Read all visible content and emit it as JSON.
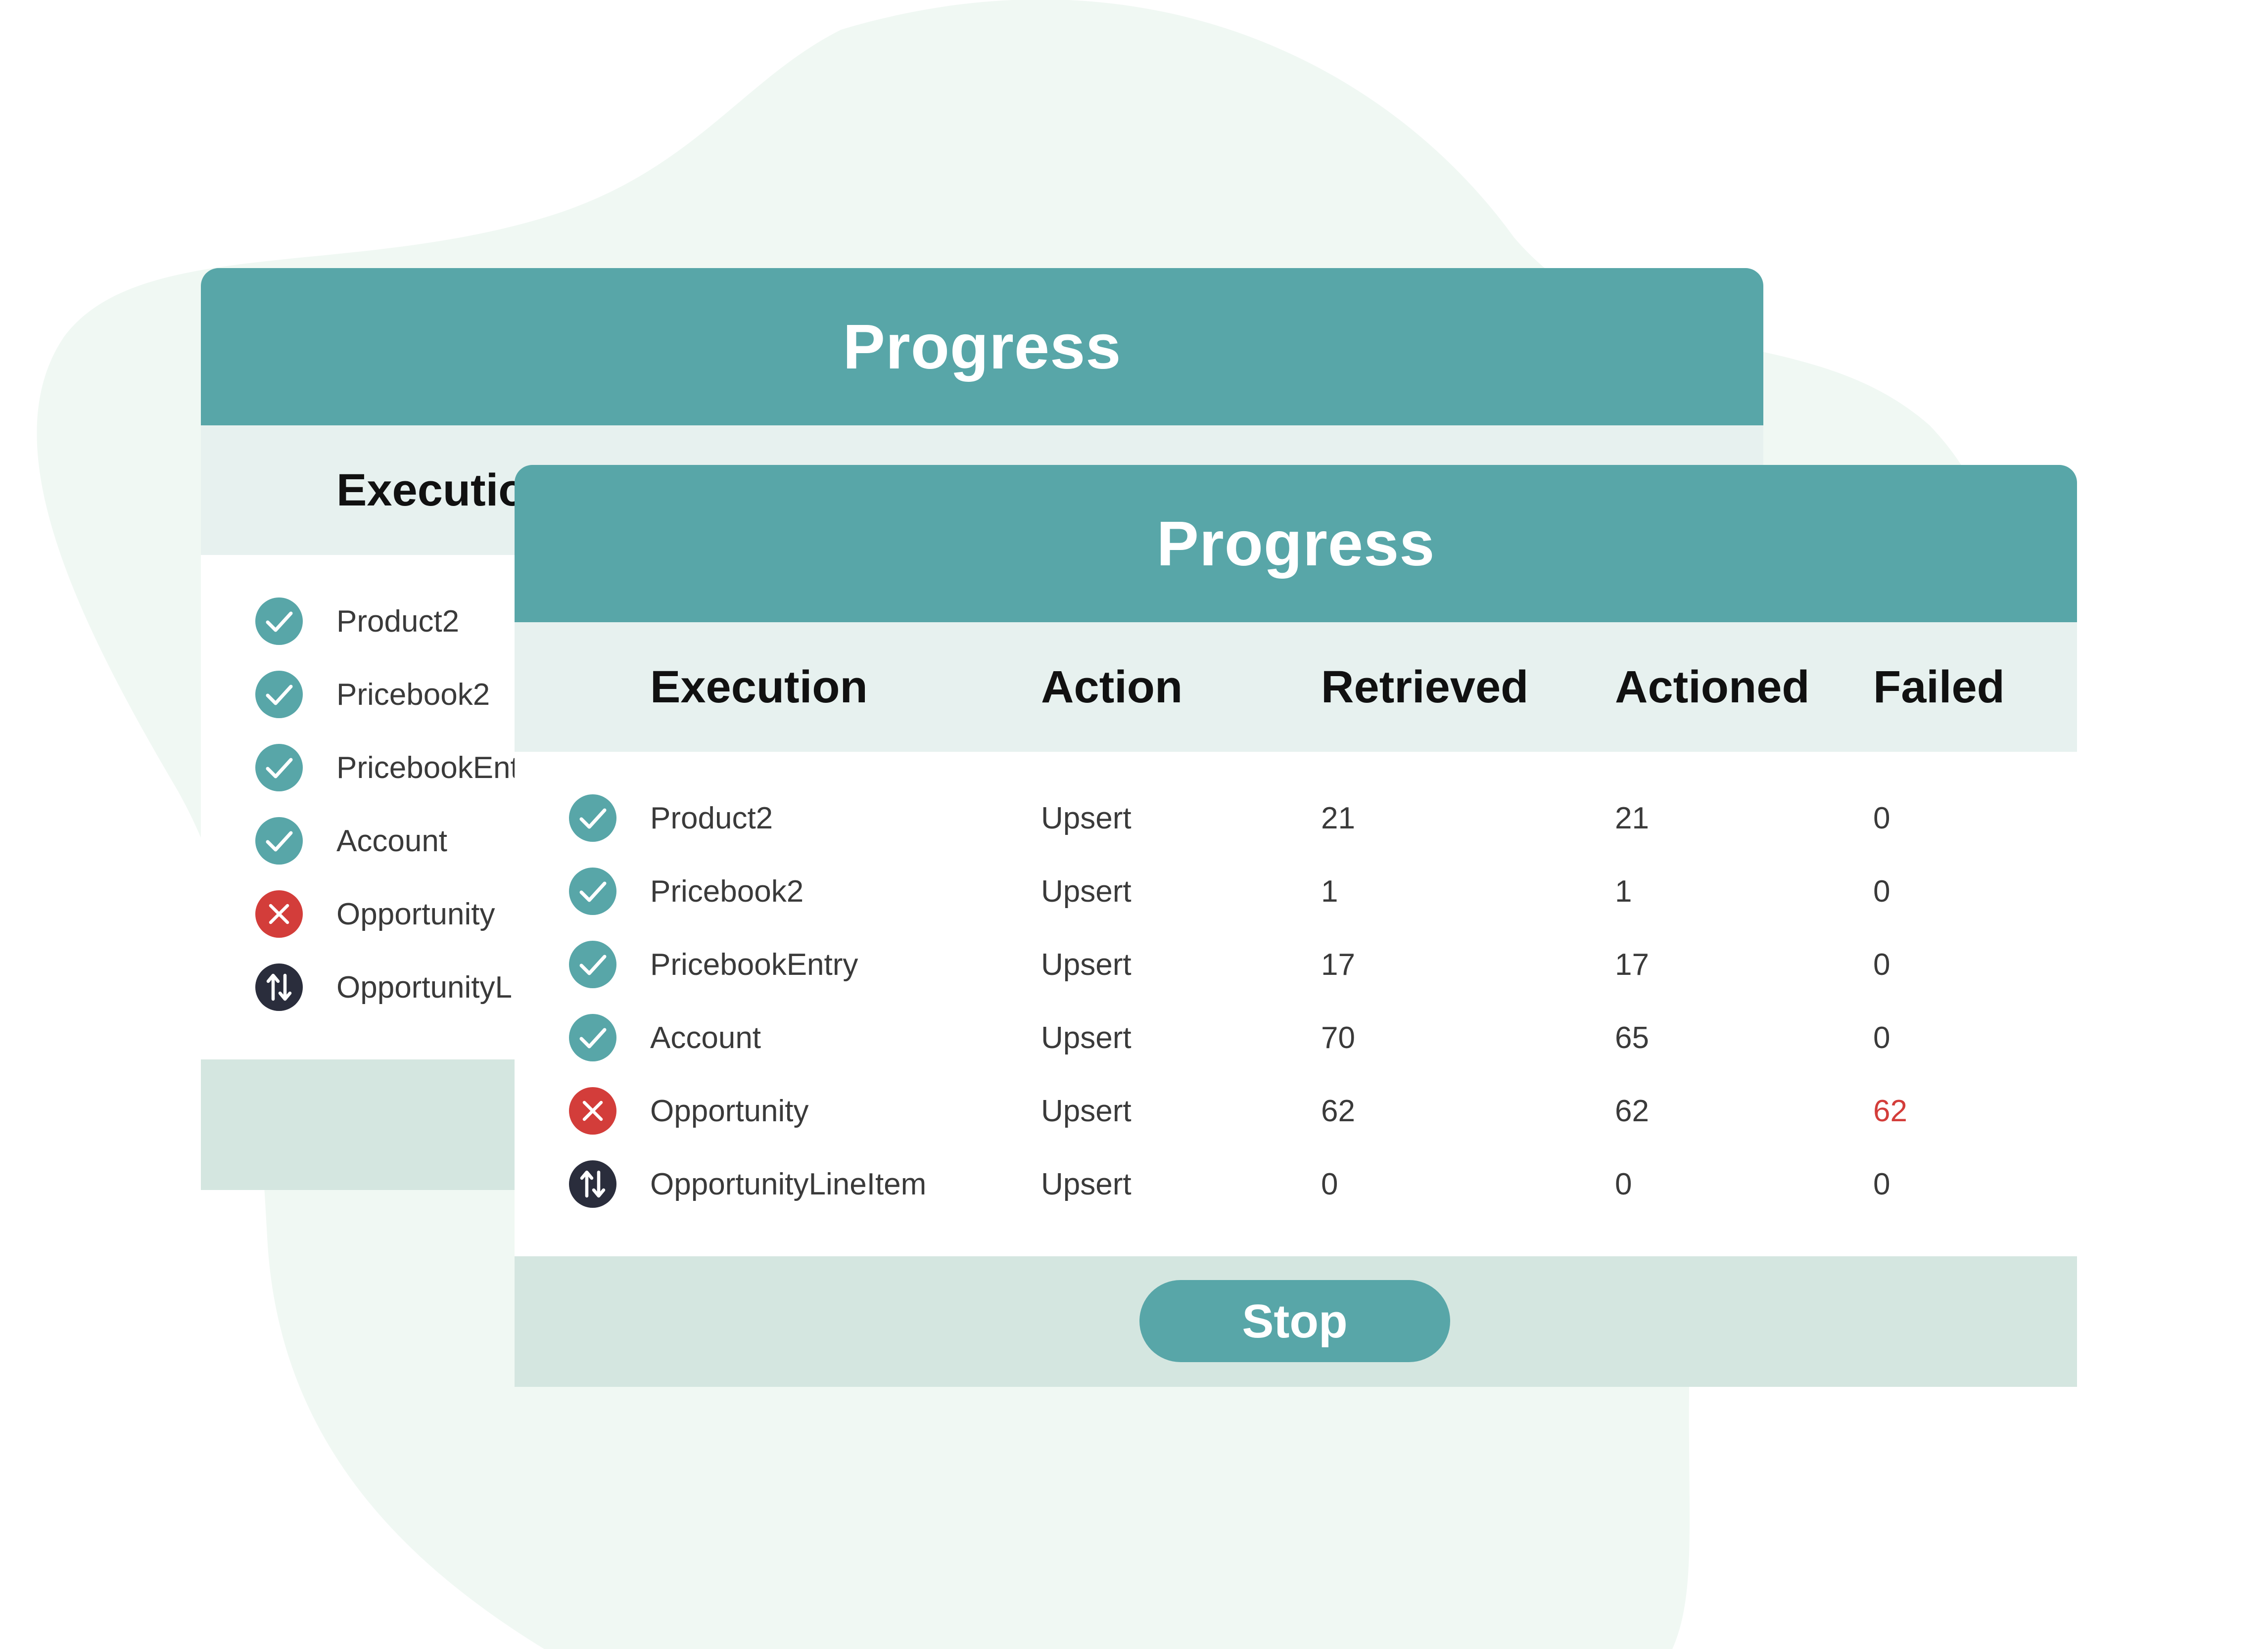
{
  "colors": {
    "header_bg": "#58a6a8",
    "column_bar_bg": "#e7f1ef",
    "footer_bg": "#d4e6e0",
    "success_icon": "#58a6a8",
    "error_icon": "#d33d3a",
    "pending_icon": "#2a2d3c",
    "failed_text": "#d33d3a",
    "background_blob": "#f0f8f3"
  },
  "back_panel": {
    "title": "Progress",
    "column_label": "Executio",
    "rows": [
      {
        "name": "Product2",
        "status": "success",
        "icon": "check-circle-icon"
      },
      {
        "name": "Pricebook2",
        "status": "success",
        "icon": "check-circle-icon"
      },
      {
        "name": "PricebookEnt",
        "status": "success",
        "icon": "check-circle-icon"
      },
      {
        "name": "Account",
        "status": "success",
        "icon": "check-circle-icon"
      },
      {
        "name": "Opportunity",
        "status": "error",
        "icon": "error-x-icon"
      },
      {
        "name": "OpportunityL",
        "status": "pending",
        "icon": "sync-arrows-icon"
      }
    ]
  },
  "front_panel": {
    "title": "Progress",
    "columns": [
      "Execution",
      "Action",
      "Retrieved",
      "Actioned",
      "Failed"
    ],
    "rows": [
      {
        "name": "Product2",
        "action": "Upsert",
        "retrieved": "21",
        "actioned": "21",
        "failed": "0",
        "status": "success",
        "icon": "check-circle-icon"
      },
      {
        "name": "Pricebook2",
        "action": "Upsert",
        "retrieved": "1",
        "actioned": "1",
        "failed": "0",
        "status": "success",
        "icon": "check-circle-icon"
      },
      {
        "name": "PricebookEntry",
        "action": "Upsert",
        "retrieved": "17",
        "actioned": "17",
        "failed": "0",
        "status": "success",
        "icon": "check-circle-icon"
      },
      {
        "name": "Account",
        "action": "Upsert",
        "retrieved": "70",
        "actioned": "65",
        "failed": "0",
        "status": "success",
        "icon": "check-circle-icon"
      },
      {
        "name": "Opportunity",
        "action": "Upsert",
        "retrieved": "62",
        "actioned": "62",
        "failed": "62",
        "status": "error",
        "icon": "error-x-icon"
      },
      {
        "name": "OpportunityLineItem",
        "action": "Upsert",
        "retrieved": "0",
        "actioned": "0",
        "failed": "0",
        "status": "pending",
        "icon": "sync-arrows-icon"
      }
    ],
    "stop_label": "Stop"
  }
}
